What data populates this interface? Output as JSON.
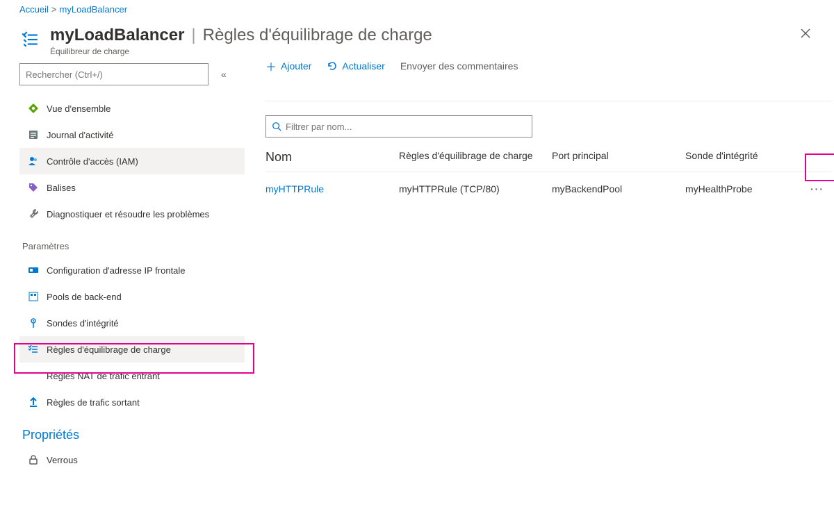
{
  "breadcrumb": {
    "home": "Accueil",
    "current": "myLoadBalancer"
  },
  "header": {
    "resource": "myLoadBalancer",
    "section": "Règles d'équilibrage de charge",
    "subtitle": "Équilibreur de charge"
  },
  "sidebar": {
    "search_placeholder": "Rechercher (Ctrl+/)",
    "items": {
      "overview": "Vue d'ensemble",
      "activity": "Journal d'activité",
      "iam": "Contrôle d'accès (IAM)",
      "tags": "Balises",
      "diagnose": "Diagnostiquer et résoudre les problèmes"
    },
    "settings_label": "Paramètres",
    "settings": {
      "frontend_ip": "Configuration d'adresse IP frontale",
      "backend_pools": "Pools de back-end",
      "health_probes": "Sondes d'intégrité",
      "lb_rules": "Règles d'équilibrage de charge",
      "nat_rules": "Règles NAT de trafic entrant",
      "outbound_rules": "Règles de trafic sortant"
    },
    "properties_label": "Propriétés",
    "properties": {
      "locks": "Verrous"
    }
  },
  "toolbar": {
    "add": "Ajouter",
    "refresh": "Actualiser",
    "feedback": "Envoyer des commentaires"
  },
  "filter": {
    "placeholder": "Filtrer par nom..."
  },
  "table": {
    "headers": {
      "name": "Nom",
      "rule": "Règles d'équilibrage de charge",
      "port": "Port principal",
      "health": "Sonde d'intégrité"
    },
    "rows": [
      {
        "name": "myHTTPRule",
        "rule": "myHTTPRule (TCP/80)",
        "port": "myBackendPool",
        "health": "myHealthProbe"
      }
    ]
  }
}
